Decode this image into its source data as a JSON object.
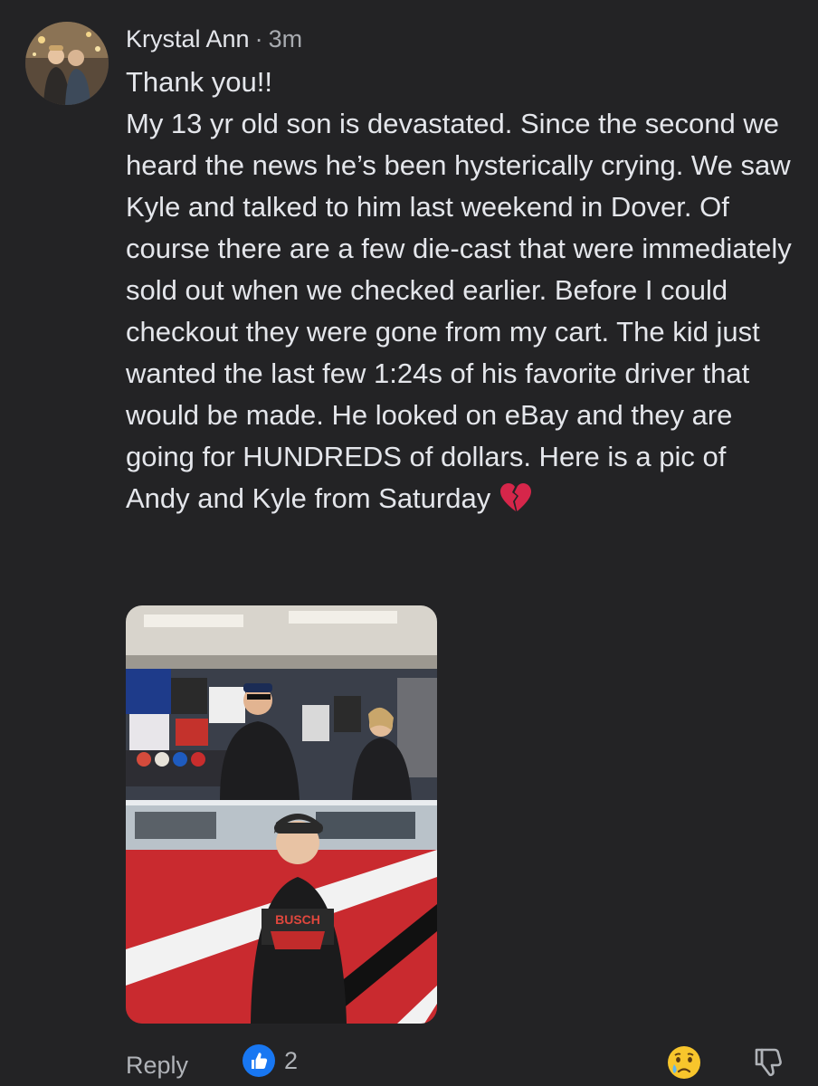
{
  "comment": {
    "author": "Krystal Ann",
    "separator": "·",
    "time": "3m",
    "body_lines": [
      "Thank you!!",
      "My 13 yr old son is devastated. Since the second we heard the news he’s been hysterically crying. We saw Kyle and talked to him last weekend in Dover. Of course there are a few die-cast that were immediately sold out when we checked earlier. Before I could checkout they were gone from my cart. The kid just wanted the last few 1:24s of his favorite driver that would be made. He looked on eBay and they are going for HUNDREDS of dollars. Here is a pic of Andy and Kyle from Saturday"
    ],
    "emoji": "broken-heart-icon",
    "photo_shirt_text": "BUSCH"
  },
  "footer": {
    "reply_label": "Reply",
    "like_count": "2",
    "like_icon": "thumbs-up-icon",
    "react_icon": "sad-tear-face-icon",
    "dislike_icon": "thumbs-down-icon"
  },
  "colors": {
    "background": "#232325",
    "text_primary": "#e4e6eb",
    "text_secondary": "#a8abb0",
    "like_blue": "#1877f2"
  }
}
